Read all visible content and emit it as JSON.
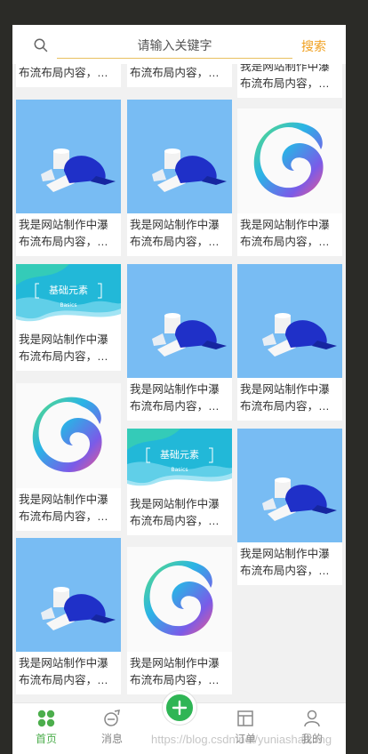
{
  "search": {
    "placeholder": "请输入关键字",
    "button_label": "搜索"
  },
  "caption": {
    "line1": "我是网站制作中瀑",
    "line2": "布流布局内容，内容"
  },
  "images": {
    "product": "product-photo",
    "logo": "swirl-logo",
    "banner": {
      "title": "基础元素",
      "subtitle": "Basics"
    }
  },
  "columns": [
    [
      {
        "image": "product",
        "caption": true
      },
      {
        "image": "banner",
        "caption": true
      },
      {
        "image": "logo",
        "caption": true
      },
      {
        "image": "product",
        "caption": true
      }
    ],
    [
      {
        "image": "product",
        "caption": true
      },
      {
        "image": "product",
        "caption": true
      },
      {
        "image": "banner",
        "caption": true
      },
      {
        "image": "logo",
        "caption": true
      }
    ],
    [
      {
        "image": "logo",
        "caption": true
      },
      {
        "image": "product",
        "caption": true
      },
      {
        "image": "product",
        "caption": true
      }
    ]
  ],
  "tabbar": {
    "items": [
      {
        "label": "首页",
        "icon": "grid-icon",
        "active": true
      },
      {
        "label": "消息",
        "icon": "message-icon",
        "active": false
      },
      {
        "label": "订单",
        "icon": "order-icon",
        "active": false
      },
      {
        "label": "我的",
        "icon": "user-icon",
        "active": false
      }
    ],
    "fab_icon": "plus-icon"
  },
  "watermark": "https://blog.csdn.net/yuniashaikong",
  "colors": {
    "accent_green": "#2fb555",
    "search_orange": "#f0a020",
    "tile_blue": "#78bcf3"
  }
}
